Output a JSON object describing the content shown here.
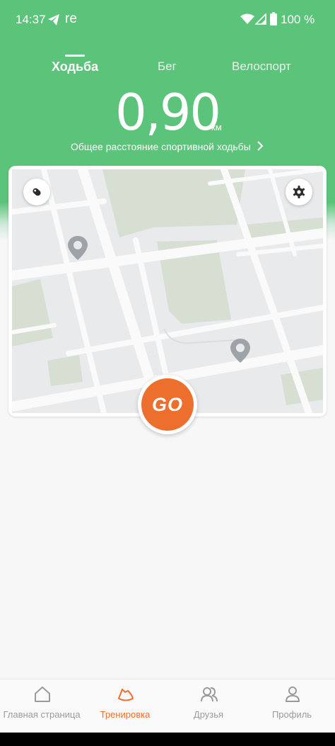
{
  "status_bar": {
    "time": "14:37",
    "app_indicator": "re",
    "battery": "100 %",
    "icons": [
      "send-icon",
      "wifi-icon",
      "signal-icon",
      "battery-icon"
    ]
  },
  "tabs": [
    {
      "label": "Ходьба",
      "active": true
    },
    {
      "label": "Бег",
      "active": false
    },
    {
      "label": "Велоспорт",
      "active": false
    }
  ],
  "distance": {
    "value": "0,90",
    "unit": "км",
    "caption": "Общее расстояние спортивной ходьбы"
  },
  "map": {
    "left_button_icon": "shoe-icon",
    "right_button_icon": "gear-icon",
    "pin_icon": "location-pin-icon"
  },
  "go_button": {
    "label": "GO",
    "color": "#ec6f2d"
  },
  "bottom_nav": {
    "items": [
      {
        "label": "Главная страница",
        "icon": "home-icon",
        "active": false
      },
      {
        "label": "Тренировка",
        "icon": "sneaker-icon",
        "active": true
      },
      {
        "label": "Друзья",
        "icon": "friends-icon",
        "active": false
      },
      {
        "label": "Профиль",
        "icon": "profile-icon",
        "active": false
      }
    ]
  },
  "colors": {
    "header_green": "#5cc47a",
    "accent_orange": "#ec6f2d",
    "inactive_nav": "#9a9a9a"
  }
}
